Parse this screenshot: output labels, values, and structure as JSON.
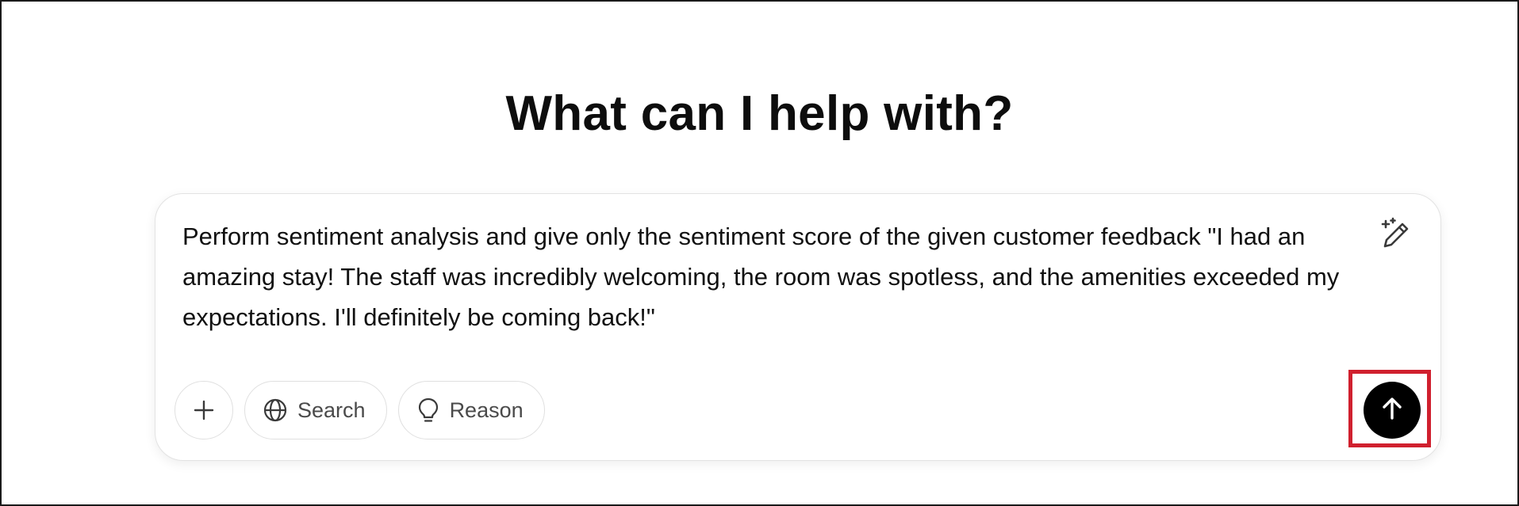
{
  "heading": {
    "title": "What can I help with?"
  },
  "composer": {
    "prompt_text": "Perform sentiment analysis and give only the sentiment score of the given customer feedback \"I had an amazing stay! The staff was incredibly welcoming, the room was spotless, and the amenities exceeded my expectations. I'll definitely be coming back!\"",
    "icons": {
      "edit": "magic-pencil-icon",
      "add": "plus-icon",
      "search": "globe-icon",
      "reason": "lightbulb-icon",
      "send": "arrow-up-icon"
    },
    "toolbar": {
      "search_label": "Search",
      "reason_label": "Reason"
    }
  },
  "colors": {
    "highlight": "#d0202e",
    "send_bg": "#000000",
    "text": "#0d0d0d"
  }
}
